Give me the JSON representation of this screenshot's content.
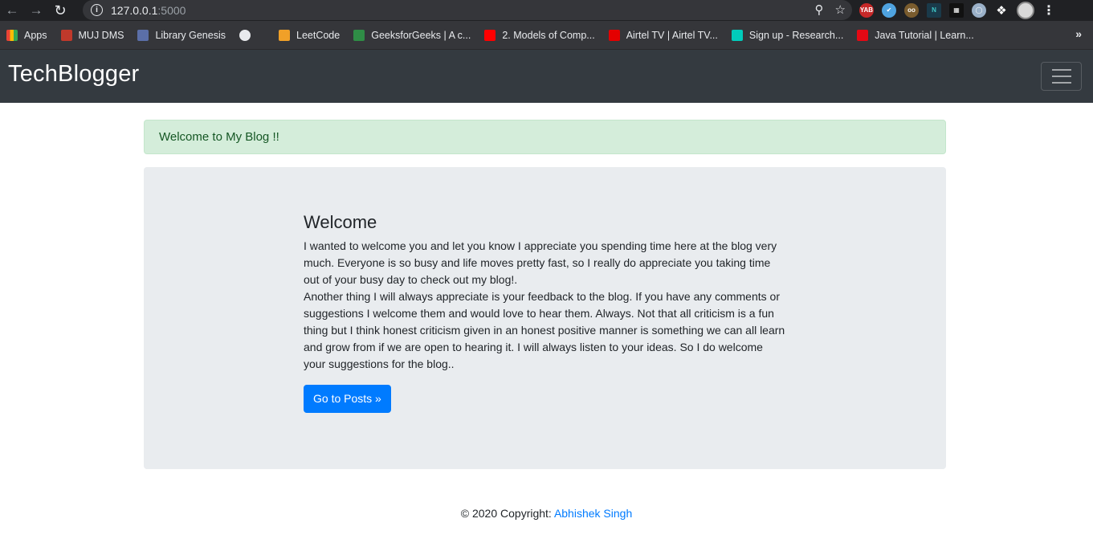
{
  "browser": {
    "url_host": "127.0.0.1",
    "url_port": ":5000",
    "bookmarks": [
      {
        "label": "Apps",
        "icon": "apps-grid-icon",
        "color": "#e8710a"
      },
      {
        "label": "MUJ DMS",
        "icon": "muj-icon",
        "color": "#c0392b"
      },
      {
        "label": "Library Genesis",
        "icon": "book-icon",
        "color": "#5b6fa8"
      },
      {
        "label": "",
        "icon": "globe-icon",
        "color": "#e8eaed"
      },
      {
        "label": "LeetCode",
        "icon": "leetcode-icon",
        "color": "#f0a028"
      },
      {
        "label": "GeeksforGeeks | A c...",
        "icon": "gfg-icon",
        "color": "#2f8d46"
      },
      {
        "label": "2. Models of Comp...",
        "icon": "youtube-icon",
        "color": "#ff0000"
      },
      {
        "label": "Airtel TV | Airtel TV...",
        "icon": "airtel-icon",
        "color": "#e40000"
      },
      {
        "label": "Sign up - Research...",
        "icon": "researchgate-icon",
        "color": "#00ccbb"
      },
      {
        "label": "Java Tutorial | Learn...",
        "icon": "java-icon",
        "color": "#e50914"
      }
    ],
    "more": "»"
  },
  "navbar": {
    "brand": "TechBlogger"
  },
  "alert": {
    "message": "Welcome to My Blog !!"
  },
  "jumbotron": {
    "title": "Welcome",
    "paragraph1": "I wanted to welcome you and let you know I appreciate you spending time here at the blog very much. Everyone is so busy and life moves pretty fast, so I really do appreciate you taking time out of your busy day to check out my blog!.",
    "paragraph2": "Another thing I will always appreciate is your feedback to the blog. If you have any comments or suggestions I welcome them and would love to hear them. Always. Not that all criticism is a fun thing but I think honest criticism given in an honest positive manner is something we can all learn and grow from if we are open to hearing it. I will always listen to your ideas. So I do welcome your suggestions for the blog..",
    "button_label": "Go to Posts »"
  },
  "footer": {
    "copyright": "© 2020 Copyright: ",
    "author": "Abhishek Singh"
  }
}
